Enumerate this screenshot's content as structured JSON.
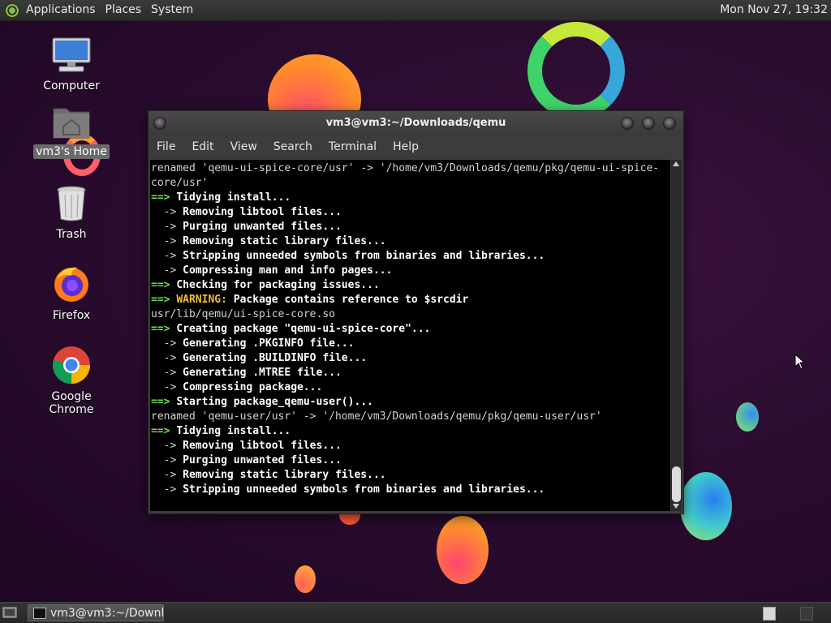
{
  "top_panel": {
    "menus": [
      "Applications",
      "Places",
      "System"
    ],
    "clock": "Mon Nov 27, 19:32"
  },
  "desktop": {
    "icons": [
      {
        "label": "Computer",
        "icon": "computer-icon"
      },
      {
        "label": "vm3's Home",
        "icon": "home-folder-icon"
      },
      {
        "label": "Trash",
        "icon": "trash-icon"
      },
      {
        "label": "Firefox",
        "icon": "firefox-icon"
      },
      {
        "label": "Google Chrome",
        "icon": "chrome-icon"
      }
    ]
  },
  "terminal": {
    "title": "vm3@vm3:~/Downloads/qemu",
    "menu": [
      "File",
      "Edit",
      "View",
      "Search",
      "Terminal",
      "Help"
    ],
    "lines": [
      {
        "parts": [
          {
            "t": "renamed 'qemu-ui-spice-core/usr' -> '/home/vm3/Downloads/qemu/pkg/qemu-ui-spice-",
            "s": ""
          }
        ]
      },
      {
        "parts": [
          {
            "t": "core/usr'",
            "s": ""
          }
        ]
      },
      {
        "parts": [
          {
            "t": "==> ",
            "s": "g"
          },
          {
            "t": "Tidying install...",
            "s": "b"
          }
        ]
      },
      {
        "parts": [
          {
            "t": "  -> ",
            "s": ""
          },
          {
            "t": "Removing libtool files...",
            "s": "b"
          }
        ]
      },
      {
        "parts": [
          {
            "t": "  -> ",
            "s": ""
          },
          {
            "t": "Purging unwanted files...",
            "s": "b"
          }
        ]
      },
      {
        "parts": [
          {
            "t": "  -> ",
            "s": ""
          },
          {
            "t": "Removing static library files...",
            "s": "b"
          }
        ]
      },
      {
        "parts": [
          {
            "t": "  -> ",
            "s": ""
          },
          {
            "t": "Stripping unneeded symbols from binaries and libraries...",
            "s": "b"
          }
        ]
      },
      {
        "parts": [
          {
            "t": "  -> ",
            "s": ""
          },
          {
            "t": "Compressing man and info pages...",
            "s": "b"
          }
        ]
      },
      {
        "parts": [
          {
            "t": "==> ",
            "s": "g"
          },
          {
            "t": "Checking for packaging issues...",
            "s": "b"
          }
        ]
      },
      {
        "parts": [
          {
            "t": "==> ",
            "s": "g"
          },
          {
            "t": "WARNING:",
            "s": "y"
          },
          {
            "t": " Package contains reference to $srcdir",
            "s": "b"
          }
        ]
      },
      {
        "parts": [
          {
            "t": "usr/lib/qemu/ui-spice-core.so",
            "s": ""
          }
        ]
      },
      {
        "parts": [
          {
            "t": "==> ",
            "s": "g"
          },
          {
            "t": "Creating package \"qemu-ui-spice-core\"...",
            "s": "b"
          }
        ]
      },
      {
        "parts": [
          {
            "t": "  -> ",
            "s": ""
          },
          {
            "t": "Generating .PKGINFO file...",
            "s": "b"
          }
        ]
      },
      {
        "parts": [
          {
            "t": "  -> ",
            "s": ""
          },
          {
            "t": "Generating .BUILDINFO file...",
            "s": "b"
          }
        ]
      },
      {
        "parts": [
          {
            "t": "  -> ",
            "s": ""
          },
          {
            "t": "Generating .MTREE file...",
            "s": "b"
          }
        ]
      },
      {
        "parts": [
          {
            "t": "  -> ",
            "s": ""
          },
          {
            "t": "Compressing package...",
            "s": "b"
          }
        ]
      },
      {
        "parts": [
          {
            "t": "==> ",
            "s": "g"
          },
          {
            "t": "Starting package_qemu-user()...",
            "s": "b"
          }
        ]
      },
      {
        "parts": [
          {
            "t": "renamed 'qemu-user/usr' -> '/home/vm3/Downloads/qemu/pkg/qemu-user/usr'",
            "s": ""
          }
        ]
      },
      {
        "parts": [
          {
            "t": "==> ",
            "s": "g"
          },
          {
            "t": "Tidying install...",
            "s": "b"
          }
        ]
      },
      {
        "parts": [
          {
            "t": "  -> ",
            "s": ""
          },
          {
            "t": "Removing libtool files...",
            "s": "b"
          }
        ]
      },
      {
        "parts": [
          {
            "t": "  -> ",
            "s": ""
          },
          {
            "t": "Purging unwanted files...",
            "s": "b"
          }
        ]
      },
      {
        "parts": [
          {
            "t": "  -> ",
            "s": ""
          },
          {
            "t": "Removing static library files...",
            "s": "b"
          }
        ]
      },
      {
        "parts": [
          {
            "t": "  -> ",
            "s": ""
          },
          {
            "t": "Stripping unneeded symbols from binaries and libraries...",
            "s": "b"
          }
        ]
      }
    ]
  },
  "taskbar": {
    "window_button": "vm3@vm3:~/Downl..."
  },
  "colors": {
    "prompt_green": "#6fe04e",
    "warning_yellow": "#f0c030",
    "terminal_bg": "#000000"
  }
}
